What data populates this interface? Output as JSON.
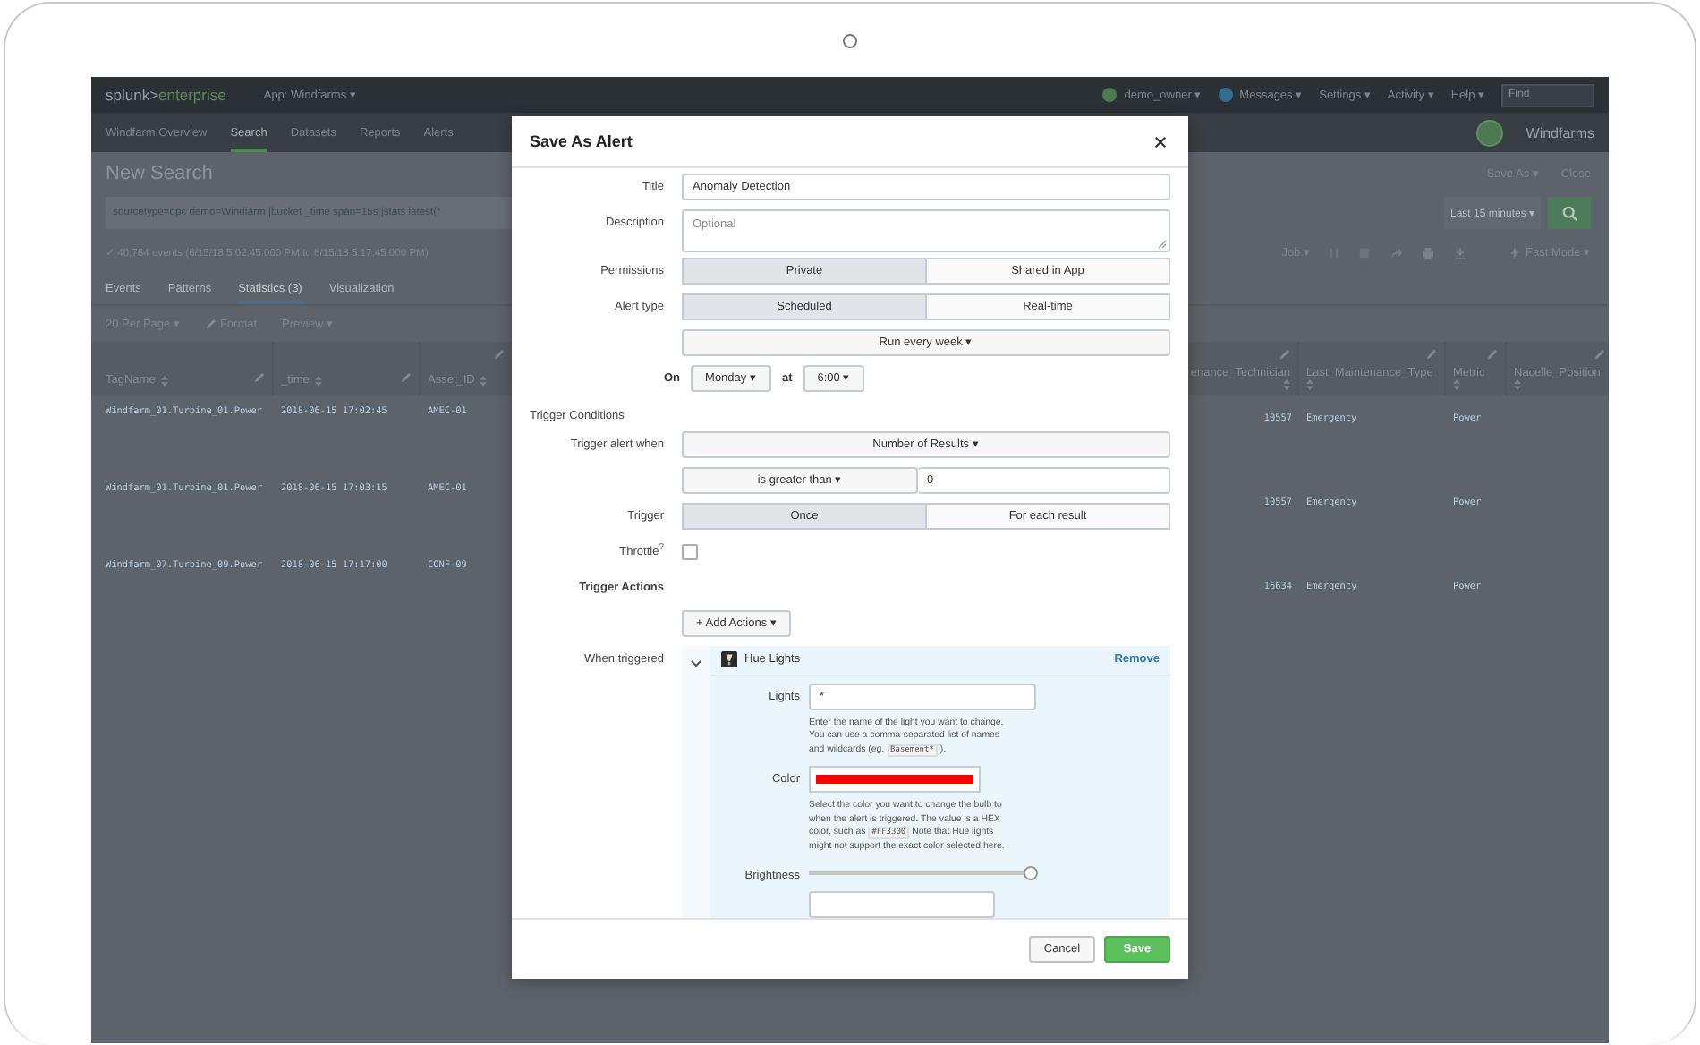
{
  "top_bar": {
    "logo": {
      "brand": "splunk>",
      "product": "enterprise"
    },
    "app_menu": "App: Windfarms ▾",
    "user": "demo_owner ▾",
    "messages": "Messages ▾",
    "menus": [
      "Settings ▾",
      "Activity ▾",
      "Help ▾"
    ],
    "search": {
      "placeholder": "Find"
    }
  },
  "nav_bar": {
    "items": [
      {
        "label": "Windfarm Overview",
        "selected": false
      },
      {
        "label": "Search",
        "selected": true
      },
      {
        "label": "Datasets",
        "selected": false
      },
      {
        "label": "Reports",
        "selected": false
      },
      {
        "label": "Alerts",
        "selected": false
      }
    ],
    "app_name": "Windfarms"
  },
  "search_page": {
    "title": "New Search",
    "actions": [
      "Save As ▾",
      "Close"
    ],
    "query": "sourcetype=opc demo=Windfarm |bucket _time span=15s |stats latest(*",
    "time_range": "Last 15 minutes ▾",
    "event_count": "✓ 40,784 events (6/15/18 5:02:45.000 PM to 6/15/18 5:17:45.000 PM)",
    "job_menu": "Job ▾",
    "mode": "Fast Mode ▾",
    "tabs": [
      {
        "label": "Events",
        "selected": false
      },
      {
        "label": "Patterns",
        "selected": false
      },
      {
        "label": "Statistics (3)",
        "selected": true
      },
      {
        "label": "Visualization",
        "selected": false
      }
    ],
    "toolbar": [
      {
        "kind": "dropdown",
        "label": "20 Per Page ▾"
      },
      {
        "kind": "edit",
        "label": "Format"
      },
      {
        "kind": "dropdown",
        "label": "Preview ▾"
      }
    ],
    "table": {
      "left_part": {
        "columns": [
          "TagName",
          "_time",
          "Asset_ID"
        ],
        "rows": [
          [
            "Windfarm_01.Turbine_01.Power",
            "2018-06-15 17:02:45",
            "AMEC-01"
          ],
          [
            "Windfarm_01.Turbine_01.Power",
            "2018-06-15 17:03:15",
            "AMEC-01"
          ],
          [
            "Windfarm_07.Turbine_09.Power",
            "2018-06-15 17:17:00",
            "CONF-09"
          ]
        ]
      },
      "right_part": {
        "columns": [
          "enance_Technician",
          "Last_Maintenance_Type",
          "Metric",
          "Nacelle_Position"
        ],
        "rows": [
          [
            "10557",
            "Emergency",
            "Power"
          ],
          [
            "10557",
            "Emergency",
            "Power"
          ],
          [
            "16634",
            "Emergency",
            "Power"
          ]
        ]
      }
    }
  },
  "modal": {
    "title": "Save As Alert",
    "fields": [
      {
        "kind": "text",
        "label": "Title",
        "value": "Anomaly Detection"
      },
      {
        "kind": "textarea",
        "label": "Description",
        "placeholder": "Optional"
      },
      {
        "kind": "segmented",
        "label": "Permissions",
        "options": [
          {
            "label": "Private",
            "selected": true
          },
          {
            "label": "Shared in App",
            "selected": false
          }
        ]
      },
      {
        "kind": "segmented",
        "label": "Alert type",
        "options": [
          {
            "label": "Scheduled",
            "selected": true
          },
          {
            "label": "Real-time",
            "selected": false
          }
        ]
      },
      {
        "kind": "dropdown",
        "value": "Run every week ▾"
      },
      {
        "kind": "schedule",
        "on": "On",
        "day": "Monday ▾",
        "at": "at",
        "time": "6:00 ▾"
      },
      {
        "kind": "heading",
        "label": "Trigger Conditions"
      },
      {
        "kind": "dropdown",
        "label": "Trigger alert when",
        "value": "Number of Results ▾"
      },
      {
        "kind": "comparison",
        "operator": "is greater than ▾",
        "value": "0"
      },
      {
        "kind": "segmented",
        "label": "Trigger",
        "options": [
          {
            "label": "Once",
            "selected": true
          },
          {
            "label": "For each result",
            "selected": false
          }
        ]
      },
      {
        "kind": "checkbox",
        "label": "Throttle",
        "help": "?",
        "checked": false
      },
      {
        "kind": "subheading",
        "label": "Trigger Actions"
      },
      {
        "kind": "button",
        "value": "+ Add Actions ▾"
      },
      {
        "kind": "action",
        "label": "When triggered",
        "expanded": true,
        "name": "Hue Lights",
        "remove": "Remove",
        "settings": [
          {
            "kind": "text",
            "label": "Lights",
            "value": "*",
            "help": "Enter the name of the light you want to change. You can use a comma-separated list of names and wildcards (eg.",
            "code": "Basement*",
            "help_end": ")."
          },
          {
            "kind": "color",
            "label": "Color",
            "color": "#ff0000",
            "help": "Select the color you want to change the bulb to when the alert is triggered. The value is a HEX color, such as",
            "code": "#FF3300",
            "help_end": "Note that Hue lights might not support the exact color selected here."
          },
          {
            "kind": "slider",
            "label": "Brightness",
            "level": 1.0
          },
          {
            "kind": "blank"
          }
        ]
      }
    ],
    "buttons": [
      {
        "kind": "default",
        "label": "Cancel"
      },
      {
        "kind": "primary",
        "label": "Save"
      }
    ]
  }
}
